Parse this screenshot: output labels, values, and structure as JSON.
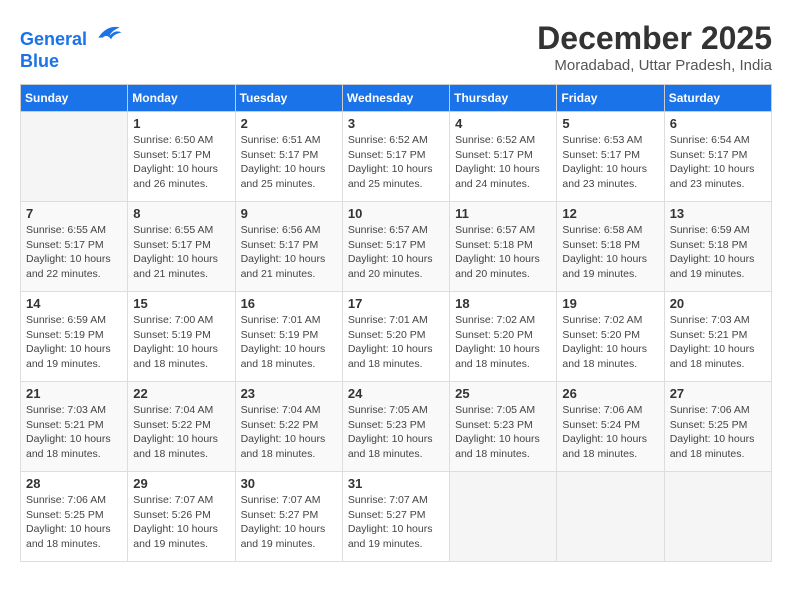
{
  "header": {
    "logo_line1": "General",
    "logo_line2": "Blue",
    "month_title": "December 2025",
    "location": "Moradabad, Uttar Pradesh, India"
  },
  "weekdays": [
    "Sunday",
    "Monday",
    "Tuesday",
    "Wednesday",
    "Thursday",
    "Friday",
    "Saturday"
  ],
  "weeks": [
    [
      {
        "day": "",
        "info": ""
      },
      {
        "day": "1",
        "info": "Sunrise: 6:50 AM\nSunset: 5:17 PM\nDaylight: 10 hours\nand 26 minutes."
      },
      {
        "day": "2",
        "info": "Sunrise: 6:51 AM\nSunset: 5:17 PM\nDaylight: 10 hours\nand 25 minutes."
      },
      {
        "day": "3",
        "info": "Sunrise: 6:52 AM\nSunset: 5:17 PM\nDaylight: 10 hours\nand 25 minutes."
      },
      {
        "day": "4",
        "info": "Sunrise: 6:52 AM\nSunset: 5:17 PM\nDaylight: 10 hours\nand 24 minutes."
      },
      {
        "day": "5",
        "info": "Sunrise: 6:53 AM\nSunset: 5:17 PM\nDaylight: 10 hours\nand 23 minutes."
      },
      {
        "day": "6",
        "info": "Sunrise: 6:54 AM\nSunset: 5:17 PM\nDaylight: 10 hours\nand 23 minutes."
      }
    ],
    [
      {
        "day": "7",
        "info": "Sunrise: 6:55 AM\nSunset: 5:17 PM\nDaylight: 10 hours\nand 22 minutes."
      },
      {
        "day": "8",
        "info": "Sunrise: 6:55 AM\nSunset: 5:17 PM\nDaylight: 10 hours\nand 21 minutes."
      },
      {
        "day": "9",
        "info": "Sunrise: 6:56 AM\nSunset: 5:17 PM\nDaylight: 10 hours\nand 21 minutes."
      },
      {
        "day": "10",
        "info": "Sunrise: 6:57 AM\nSunset: 5:17 PM\nDaylight: 10 hours\nand 20 minutes."
      },
      {
        "day": "11",
        "info": "Sunrise: 6:57 AM\nSunset: 5:18 PM\nDaylight: 10 hours\nand 20 minutes."
      },
      {
        "day": "12",
        "info": "Sunrise: 6:58 AM\nSunset: 5:18 PM\nDaylight: 10 hours\nand 19 minutes."
      },
      {
        "day": "13",
        "info": "Sunrise: 6:59 AM\nSunset: 5:18 PM\nDaylight: 10 hours\nand 19 minutes."
      }
    ],
    [
      {
        "day": "14",
        "info": "Sunrise: 6:59 AM\nSunset: 5:19 PM\nDaylight: 10 hours\nand 19 minutes."
      },
      {
        "day": "15",
        "info": "Sunrise: 7:00 AM\nSunset: 5:19 PM\nDaylight: 10 hours\nand 18 minutes."
      },
      {
        "day": "16",
        "info": "Sunrise: 7:01 AM\nSunset: 5:19 PM\nDaylight: 10 hours\nand 18 minutes."
      },
      {
        "day": "17",
        "info": "Sunrise: 7:01 AM\nSunset: 5:20 PM\nDaylight: 10 hours\nand 18 minutes."
      },
      {
        "day": "18",
        "info": "Sunrise: 7:02 AM\nSunset: 5:20 PM\nDaylight: 10 hours\nand 18 minutes."
      },
      {
        "day": "19",
        "info": "Sunrise: 7:02 AM\nSunset: 5:20 PM\nDaylight: 10 hours\nand 18 minutes."
      },
      {
        "day": "20",
        "info": "Sunrise: 7:03 AM\nSunset: 5:21 PM\nDaylight: 10 hours\nand 18 minutes."
      }
    ],
    [
      {
        "day": "21",
        "info": "Sunrise: 7:03 AM\nSunset: 5:21 PM\nDaylight: 10 hours\nand 18 minutes."
      },
      {
        "day": "22",
        "info": "Sunrise: 7:04 AM\nSunset: 5:22 PM\nDaylight: 10 hours\nand 18 minutes."
      },
      {
        "day": "23",
        "info": "Sunrise: 7:04 AM\nSunset: 5:22 PM\nDaylight: 10 hours\nand 18 minutes."
      },
      {
        "day": "24",
        "info": "Sunrise: 7:05 AM\nSunset: 5:23 PM\nDaylight: 10 hours\nand 18 minutes."
      },
      {
        "day": "25",
        "info": "Sunrise: 7:05 AM\nSunset: 5:23 PM\nDaylight: 10 hours\nand 18 minutes."
      },
      {
        "day": "26",
        "info": "Sunrise: 7:06 AM\nSunset: 5:24 PM\nDaylight: 10 hours\nand 18 minutes."
      },
      {
        "day": "27",
        "info": "Sunrise: 7:06 AM\nSunset: 5:25 PM\nDaylight: 10 hours\nand 18 minutes."
      }
    ],
    [
      {
        "day": "28",
        "info": "Sunrise: 7:06 AM\nSunset: 5:25 PM\nDaylight: 10 hours\nand 18 minutes."
      },
      {
        "day": "29",
        "info": "Sunrise: 7:07 AM\nSunset: 5:26 PM\nDaylight: 10 hours\nand 19 minutes."
      },
      {
        "day": "30",
        "info": "Sunrise: 7:07 AM\nSunset: 5:27 PM\nDaylight: 10 hours\nand 19 minutes."
      },
      {
        "day": "31",
        "info": "Sunrise: 7:07 AM\nSunset: 5:27 PM\nDaylight: 10 hours\nand 19 minutes."
      },
      {
        "day": "",
        "info": ""
      },
      {
        "day": "",
        "info": ""
      },
      {
        "day": "",
        "info": ""
      }
    ]
  ]
}
